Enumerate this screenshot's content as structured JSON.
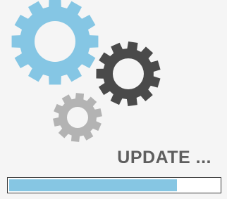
{
  "status": {
    "label": "UPDATE ..."
  },
  "progress": {
    "fraction": 0.8
  },
  "gears": [
    {
      "name": "large-blue-gear-icon",
      "color": "#85c6e4"
    },
    {
      "name": "medium-dark-gear-icon",
      "color": "#4a4a4a"
    },
    {
      "name": "small-gray-gear-icon",
      "color": "#b3b3b3"
    }
  ],
  "colors": {
    "background": "#f5f5f5",
    "progress_fill": "#86c6e3",
    "progress_border": "#3a3a3a",
    "text": "#5e5e5e"
  }
}
